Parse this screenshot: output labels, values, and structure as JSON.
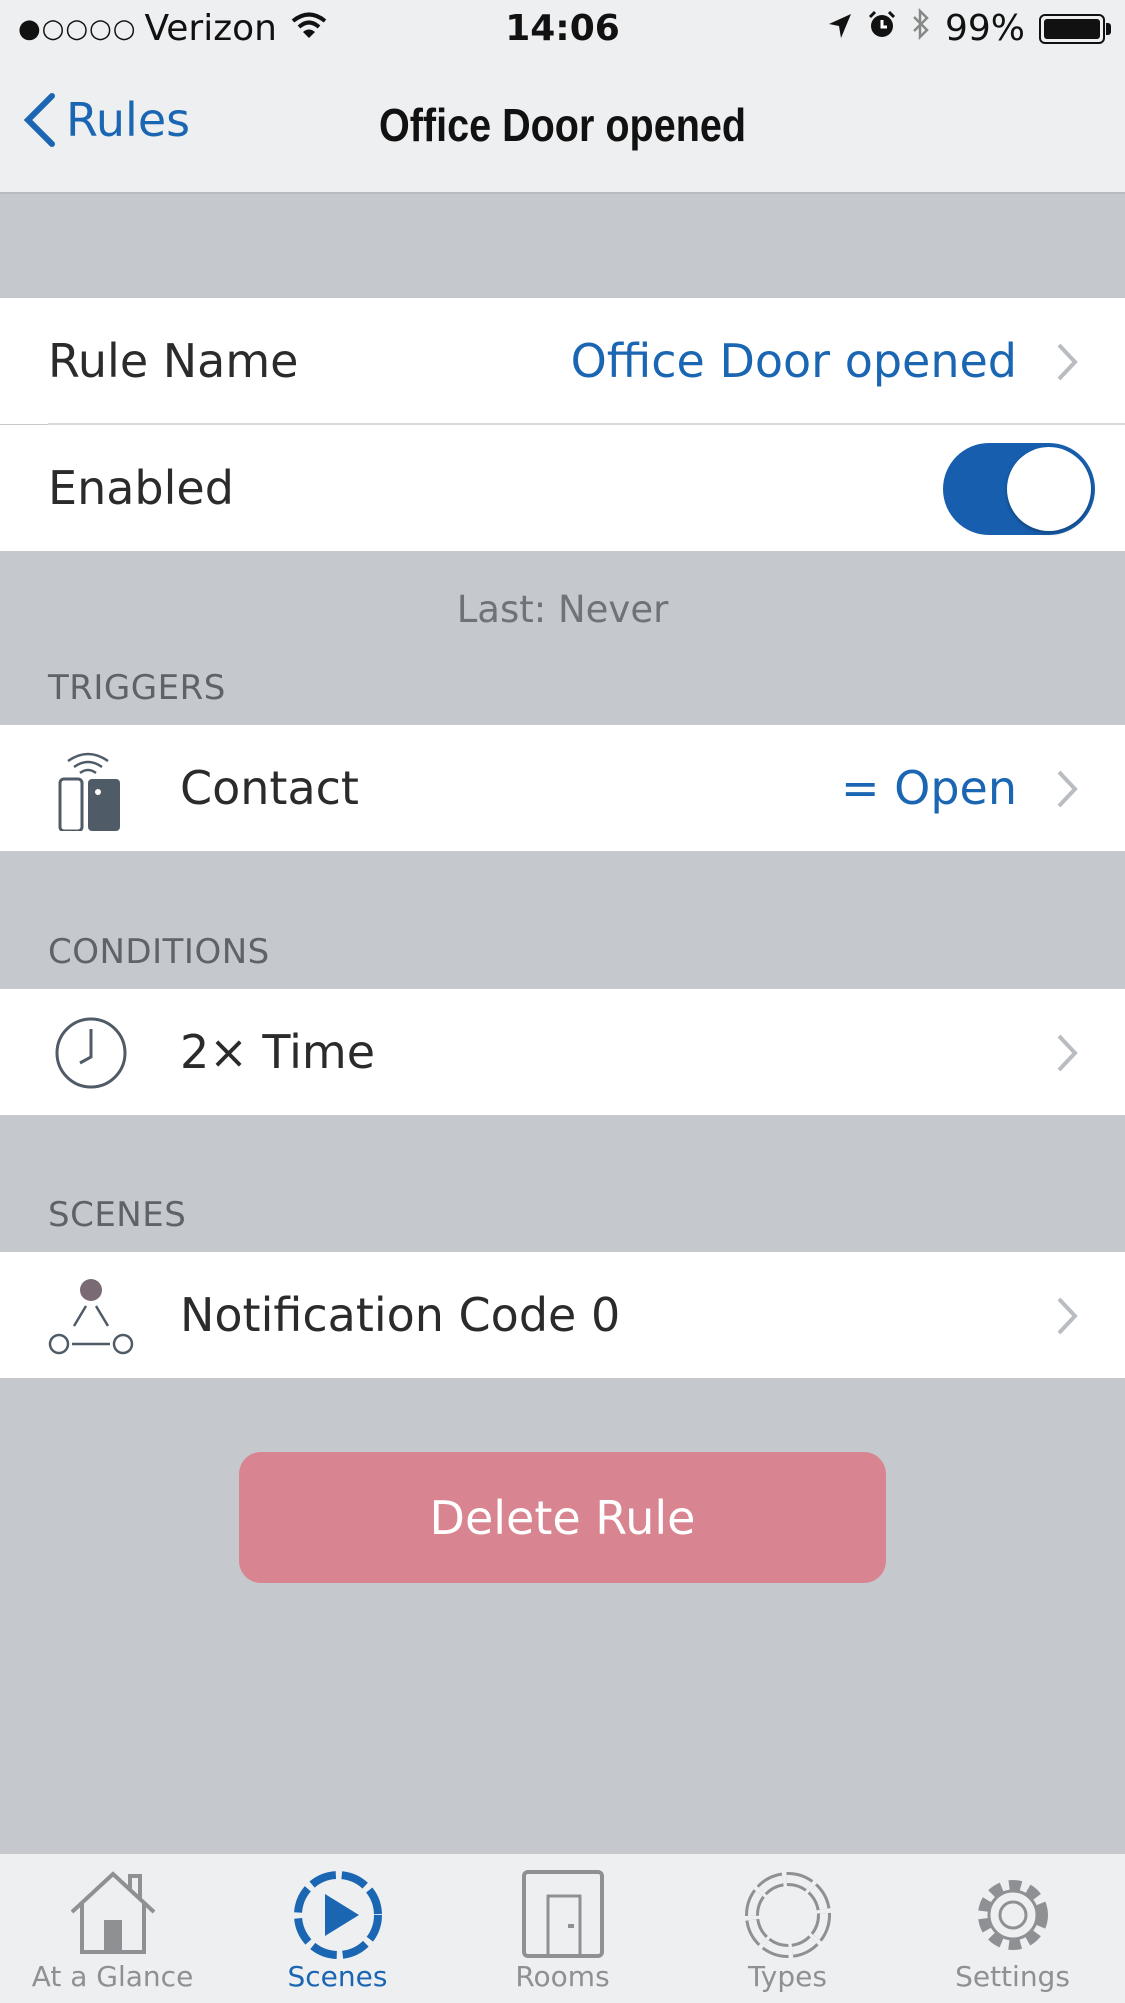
{
  "status_bar": {
    "signal_dots": "●○○○○",
    "carrier": "Verizon",
    "time": "14:06",
    "battery": "99%"
  },
  "nav": {
    "back_label": "Rules",
    "title": "Office Door opened"
  },
  "settings": {
    "rule_name_label": "Rule Name",
    "rule_name_value": "Office Door opened",
    "enabled_label": "Enabled",
    "enabled": true
  },
  "last_run": "Last: Never",
  "triggers": {
    "header": "TRIGGERS",
    "items": [
      {
        "label": "Contact",
        "value": "= Open",
        "icon": "contact-sensor-icon"
      }
    ]
  },
  "conditions": {
    "header": "CONDITIONS",
    "items": [
      {
        "label": "2× Time",
        "icon": "clock-icon"
      }
    ]
  },
  "scenes": {
    "header": "SCENES",
    "items": [
      {
        "label": "Notification Code 0",
        "icon": "scene-icon"
      }
    ]
  },
  "delete_label": "Delete Rule",
  "tabs": [
    {
      "label": "At a Glance",
      "icon": "house-icon",
      "active": false
    },
    {
      "label": "Scenes",
      "icon": "play-circle-icon",
      "active": true
    },
    {
      "label": "Rooms",
      "icon": "door-icon",
      "active": false
    },
    {
      "label": "Types",
      "icon": "segmented-circle-icon",
      "active": false
    },
    {
      "label": "Settings",
      "icon": "gear-icon",
      "active": false
    }
  ],
  "colors": {
    "accent": "#1a66b3",
    "delete": "#d88591",
    "background": "#c5c9cd"
  }
}
